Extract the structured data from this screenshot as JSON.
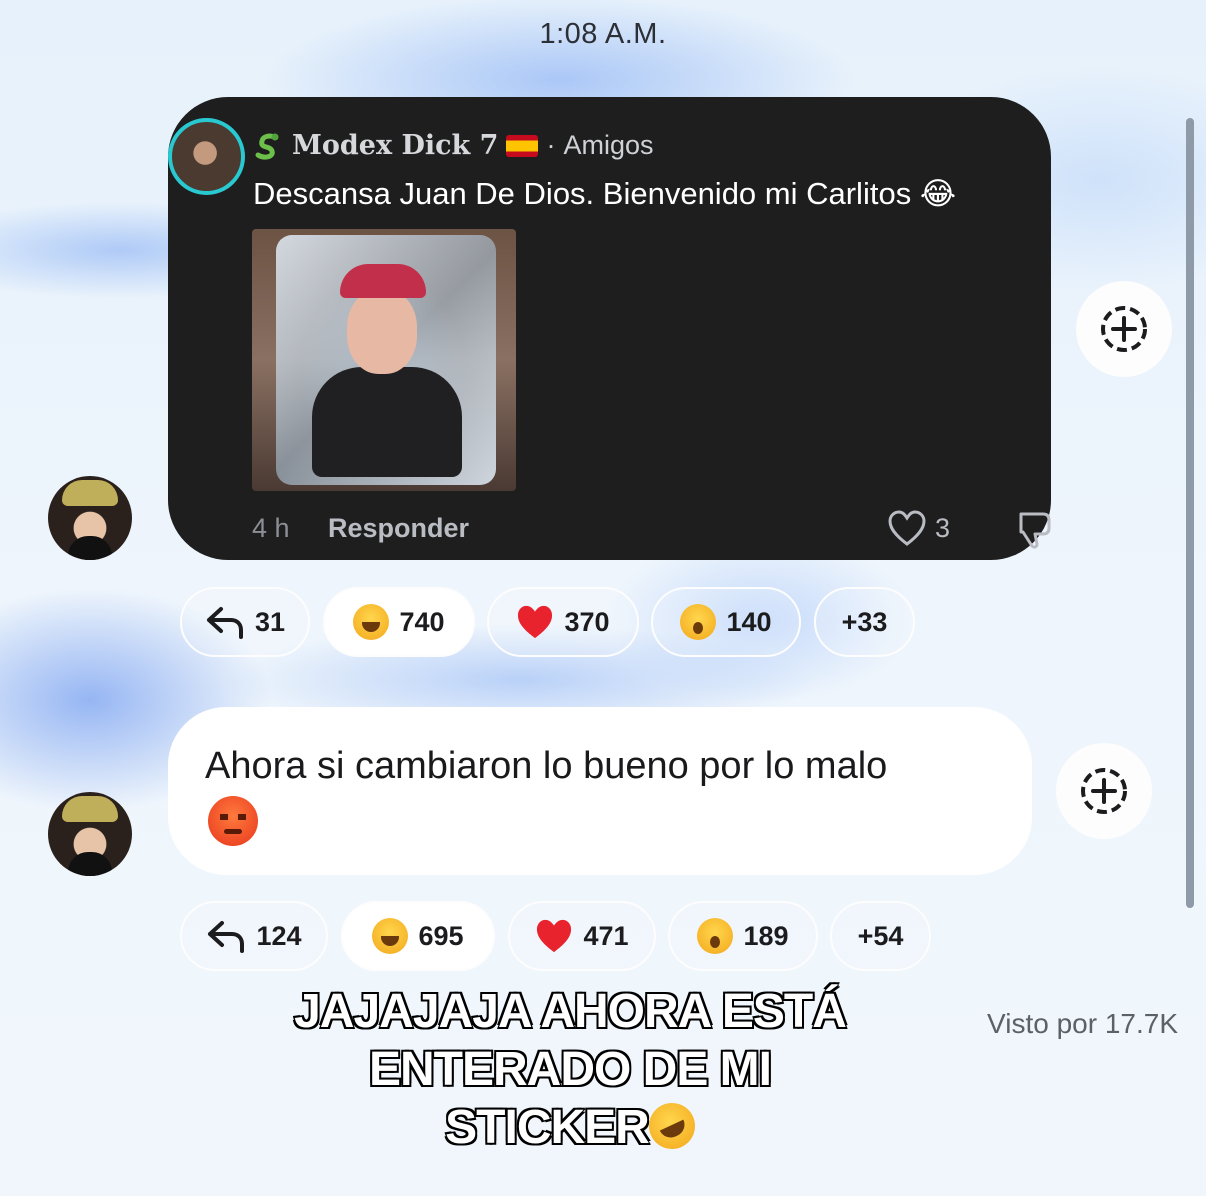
{
  "timestamp": "1:08 A.M.",
  "shared_comment": {
    "author": "Modex Dick 7",
    "author_prefix_icon": "snake-emoji",
    "author_flag": "spain-flag",
    "separator": "·",
    "relation": "Amigos",
    "text": "Descansa Juan De Dios. Bienvenido mi Carlitos",
    "text_emoji": "😂",
    "time_ago": "4 h",
    "reply_label": "Responder",
    "likes": "3"
  },
  "message1_reactions": [
    {
      "icon": "reply-arrow-icon",
      "count": "31",
      "selected": false
    },
    {
      "icon": "tears-of-joy-emoji",
      "count": "740",
      "selected": true
    },
    {
      "icon": "red-heart-emoji",
      "count": "370",
      "selected": false
    },
    {
      "icon": "surprised-emoji",
      "count": "140",
      "selected": false
    },
    {
      "icon": null,
      "count": "+33",
      "selected": false
    }
  ],
  "message2": {
    "text": "Ahora si cambiaron lo bueno por lo malo",
    "emoji": "angry-face-emoji"
  },
  "message2_reactions": [
    {
      "icon": "reply-arrow-icon",
      "count": "124",
      "selected": false
    },
    {
      "icon": "tears-of-joy-emoji",
      "count": "695",
      "selected": false
    },
    {
      "icon": "red-heart-emoji",
      "count": "471",
      "selected": false
    },
    {
      "icon": "surprised-emoji",
      "count": "189",
      "selected": false
    },
    {
      "icon": null,
      "count": "+54",
      "selected": false
    }
  ],
  "seen_by": "Visto por 17.7K",
  "caption": {
    "line1": "JAJAJAJA AHORA ESTÁ",
    "line2": "ENTERADO DE MI",
    "line3": "STICKER",
    "emoji": "rofl-emoji"
  },
  "colors": {
    "card_bg": "#1e1e1f",
    "ring": "#29c9d1",
    "bubble": "#ffffff",
    "heart": "#e8232d"
  }
}
